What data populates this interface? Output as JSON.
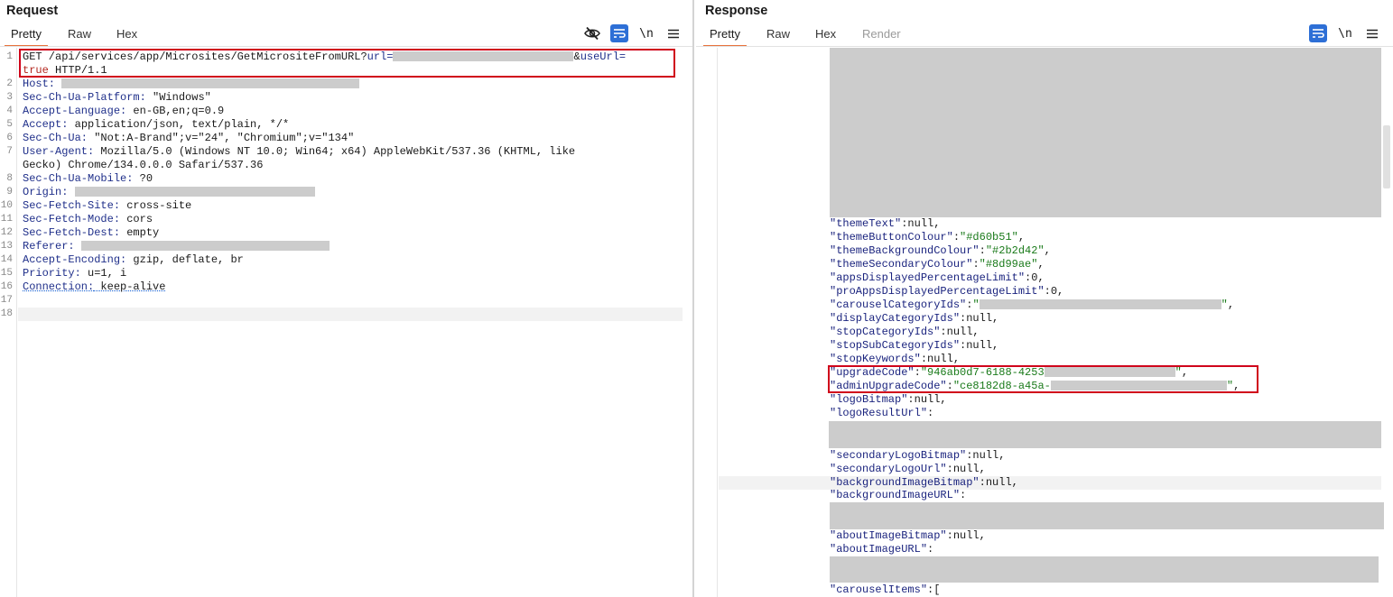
{
  "request": {
    "title": "Request",
    "tabs": [
      {
        "label": "Pretty",
        "active": true
      },
      {
        "label": "Raw"
      },
      {
        "label": "Hex"
      }
    ],
    "tools": {
      "hide_icon": "eye-slash-icon",
      "wrap_icon": "text-wrap-icon",
      "newline_label": "\\n",
      "menu_icon": "hamburger-menu-icon"
    },
    "lines": [
      {
        "n": "1",
        "method": "GET",
        "path": " /api/services/app/Microsites/GetMicrositeFromURL?",
        "p1": "url",
        "eq1": "=",
        "amp": "&",
        "p2": "useUrl",
        "eq2": "=",
        "cont": "true",
        "proto": " HTTP/1.1"
      },
      {
        "n": "2",
        "name": "Host:",
        "value": ""
      },
      {
        "n": "3",
        "name": "Sec-Ch-Ua-Platform:",
        "value": " \"Windows\""
      },
      {
        "n": "4",
        "name": "Accept-Language:",
        "value": " en-GB,en;q=0.9"
      },
      {
        "n": "5",
        "name": "Accept:",
        "value": " application/json, text/plain, */*"
      },
      {
        "n": "6",
        "name": "Sec-Ch-Ua:",
        "value": " \"Not:A-Brand\";v=\"24\", \"Chromium\";v=\"134\""
      },
      {
        "n": "7",
        "name": "User-Agent:",
        "value": " Mozilla/5.0 (Windows NT 10.0; Win64; x64) AppleWebKit/537.36 (KHTML, like",
        "cont": "Gecko) Chrome/134.0.0.0 Safari/537.36"
      },
      {
        "n": "8",
        "name": "Sec-Ch-Ua-Mobile:",
        "value": " ?0"
      },
      {
        "n": "9",
        "name": "Origin:",
        "value": ""
      },
      {
        "n": "10",
        "name": "Sec-Fetch-Site:",
        "value": " cross-site"
      },
      {
        "n": "11",
        "name": "Sec-Fetch-Mode:",
        "value": " cors"
      },
      {
        "n": "12",
        "name": "Sec-Fetch-Dest:",
        "value": " empty"
      },
      {
        "n": "13",
        "name": "Referer:",
        "value": ""
      },
      {
        "n": "14",
        "name": "Accept-Encoding:",
        "value": " gzip, deflate, br"
      },
      {
        "n": "15",
        "name": "Priority:",
        "value": " u=1, i"
      },
      {
        "n": "16",
        "name": "Connection:",
        "value": " keep-alive"
      },
      {
        "n": "17"
      },
      {
        "n": "18"
      }
    ]
  },
  "response": {
    "title": "Response",
    "tabs": [
      {
        "label": "Pretty",
        "active": true
      },
      {
        "label": "Raw"
      },
      {
        "label": "Hex"
      },
      {
        "label": "Render",
        "disabled": true
      }
    ],
    "tools": {
      "wrap_icon": "text-wrap-icon",
      "newline_label": "\\n",
      "menu_icon": "hamburger-menu-icon"
    },
    "lines": [
      {
        "key": "\"themeText\"",
        "rest": ":null,"
      },
      {
        "key": "\"themeButtonColour\"",
        "colon": ":",
        "str": "\"#d60b51\"",
        "rest": ","
      },
      {
        "key": "\"themeBackgroundColour\"",
        "colon": ":",
        "str": "\"#2b2d42\"",
        "rest": ","
      },
      {
        "key": "\"themeSecondaryColour\"",
        "colon": ":",
        "str": "\"#8d99ae\"",
        "rest": ","
      },
      {
        "key": "\"appsDisplayedPercentageLimit\"",
        "rest": ":0,"
      },
      {
        "key": "\"proAppsDisplayedPercentageLimit\"",
        "rest": ":0,"
      },
      {
        "key": "\"carouselCategoryIds\"",
        "colon": ":",
        "str": "\"",
        "end": "\"",
        "rest": ","
      },
      {
        "key": "\"displayCategoryIds\"",
        "rest": ":null,"
      },
      {
        "key": "\"stopCategoryIds\"",
        "rest": ":null,"
      },
      {
        "key": "\"stopSubCategoryIds\"",
        "rest": ":null,"
      },
      {
        "key": "\"stopKeywords\"",
        "rest": ":null,"
      },
      {
        "key": "\"upgradeCode\"",
        "colon": ":",
        "str": "\"946ab0d7-6188-4253",
        "end": "\"",
        "rest": ","
      },
      {
        "key": "\"adminUpgradeCode\"",
        "colon": ":",
        "str": "\"ce8182d8-a45a-",
        "end": "\"",
        "rest": ","
      },
      {
        "key": "\"logoBitmap\"",
        "rest": ":null,"
      },
      {
        "key": "\"logoResultUrl\"",
        "rest": ":"
      },
      {
        "key": "\"secondaryLogoBitmap\"",
        "rest": ":null,"
      },
      {
        "key": "\"secondaryLogoUrl\"",
        "rest": ":null,"
      },
      {
        "key": "\"backgroundImageBitmap\"",
        "rest": ":null,"
      },
      {
        "key": "\"backgroundImageURL\"",
        "rest": ":"
      },
      {
        "key": "\"aboutImageBitmap\"",
        "rest": ":null,"
      },
      {
        "key": "\"aboutImageURL\"",
        "rest": ":"
      },
      {
        "key": "\"carouselItems\"",
        "rest": ":["
      }
    ]
  }
}
